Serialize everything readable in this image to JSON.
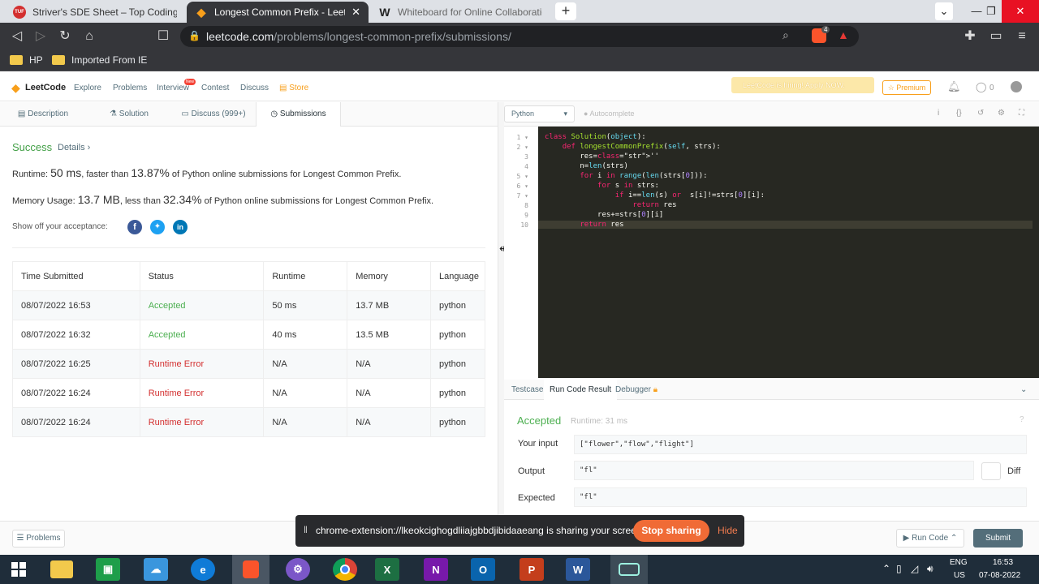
{
  "browser": {
    "tabs": [
      {
        "title": "Striver's SDE Sheet – Top Coding Inter",
        "favicon": "TUF",
        "active": false
      },
      {
        "title": "Longest Common Prefix - LeetCo",
        "favicon": "LeetCode",
        "active": true
      },
      {
        "title": "Whiteboard for Online Collaboration |",
        "favicon": "W",
        "active": false
      }
    ],
    "new_tab_label": "+",
    "url_domain": "leetcode.com",
    "url_path": "/problems/longest-common-prefix/submissions/",
    "brave_badge": "4",
    "bookmarks": [
      "HP",
      "Imported From IE"
    ]
  },
  "lc_nav": {
    "logo": "LeetCode",
    "links": [
      "Explore",
      "Problems",
      "Interview",
      "Contest",
      "Discuss",
      "Store"
    ],
    "interview_badge": "New",
    "hiring_banner": "LeetCode is hiring! Apply NOW.",
    "premium": "Premium",
    "streak": "0"
  },
  "left_tabs": [
    "Description",
    "Solution",
    "Discuss (999+)",
    "Submissions"
  ],
  "result": {
    "status": "Success",
    "details": "Details",
    "runtime_label": "Runtime:",
    "runtime_value": "50 ms",
    "runtime_mid": ", faster than",
    "runtime_pct": "13.87%",
    "runtime_tail": "of Python online submissions for Longest Common Prefix.",
    "memory_label": "Memory Usage:",
    "memory_value": "13.7 MB",
    "memory_mid": ", less than",
    "memory_pct": "32.34%",
    "memory_tail": "of Python online submissions for Longest Common Prefix.",
    "show_off": "Show off your acceptance:"
  },
  "table": {
    "headers": [
      "Time Submitted",
      "Status",
      "Runtime",
      "Memory",
      "Language"
    ],
    "rows": [
      {
        "time": "08/07/2022 16:53",
        "status": "Accepted",
        "runtime": "50 ms",
        "memory": "13.7 MB",
        "lang": "python"
      },
      {
        "time": "08/07/2022 16:32",
        "status": "Accepted",
        "runtime": "40 ms",
        "memory": "13.5 MB",
        "lang": "python"
      },
      {
        "time": "08/07/2022 16:25",
        "status": "Runtime Error",
        "runtime": "N/A",
        "memory": "N/A",
        "lang": "python"
      },
      {
        "time": "08/07/2022 16:24",
        "status": "Runtime Error",
        "runtime": "N/A",
        "memory": "N/A",
        "lang": "python"
      },
      {
        "time": "08/07/2022 16:24",
        "status": "Runtime Error",
        "runtime": "N/A",
        "memory": "N/A",
        "lang": "python"
      }
    ]
  },
  "editor": {
    "language": "Python",
    "autocomplete": "Autocomplete",
    "lines": [
      "class Solution(object):",
      "    def longestCommonPrefix(self, strs):",
      "        res=''",
      "        n=len(strs)",
      "        for i in range(len(strs[0])):",
      "            for s in strs:",
      "                if i==len(s) or  s[i]!=strs[0][i]:",
      "                    return res",
      "            res+=strs[0][i]",
      "        return res"
    ]
  },
  "result_panel": {
    "tabs": [
      "Testcase",
      "Run Code Result",
      "Debugger"
    ],
    "status": "Accepted",
    "runtime": "Runtime: 31 ms",
    "input_label": "Your input",
    "input_value": "[\"flower\",\"flow\",\"flight\"]",
    "output_label": "Output",
    "output_value": "\"fl\"",
    "diff": "Diff",
    "expected_label": "Expected",
    "expected_value": "\"fl\""
  },
  "bottom": {
    "problems": "Problems",
    "run_code": "Run Code",
    "submit": "Submit"
  },
  "share_bar": {
    "message": "chrome-extension://lkeokcighogdliiajgbbdjibidaaeang is sharing your screen.",
    "stop": "Stop sharing",
    "hide": "Hide"
  },
  "taskbar": {
    "lang1": "ENG",
    "lang2": "US",
    "time": "16:53",
    "date": "07-08-2022"
  }
}
